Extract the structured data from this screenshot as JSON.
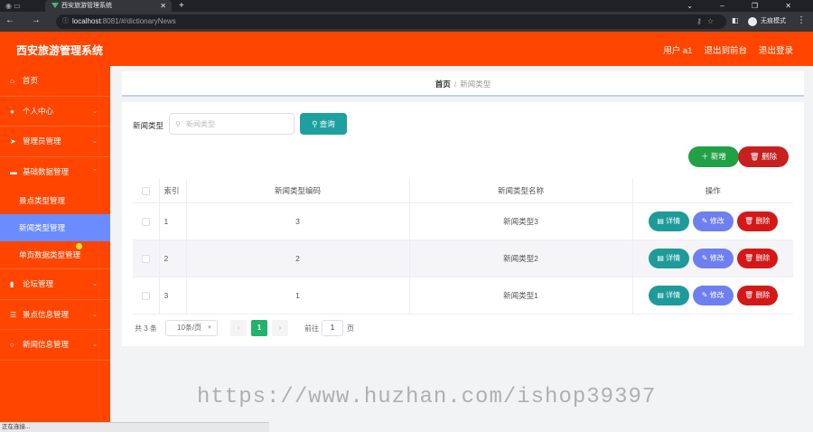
{
  "browser": {
    "tab_title": "西安旅游管理系统",
    "url_host": "localhost",
    "url_rest": ":8081/#/dictionaryNews",
    "incognito_label": "无痕模式"
  },
  "header": {
    "title": "西安旅游管理系统",
    "user": "用户 a1",
    "to_front": "退出到前台",
    "logout": "退出登录"
  },
  "sidebar": {
    "items": [
      {
        "label": "首页",
        "icon": "home-icon",
        "has_arrow": false
      },
      {
        "label": "个人中心",
        "icon": "user-icon",
        "has_arrow": true
      },
      {
        "label": "管理员管理",
        "icon": "send-icon",
        "has_arrow": true
      },
      {
        "label": "基础数据管理",
        "icon": "monitor-icon",
        "has_arrow": true,
        "expanded": true,
        "children": [
          "景点类型管理",
          "新闻类型管理",
          "单页数据类型管理"
        ]
      },
      {
        "label": "论坛管理",
        "icon": "chart-icon",
        "has_arrow": true
      },
      {
        "label": "景点信息管理",
        "icon": "list-icon",
        "has_arrow": true
      },
      {
        "label": "新闻信息管理",
        "icon": "info-icon",
        "has_arrow": true
      }
    ],
    "active_child": "新闻类型管理"
  },
  "breadcrumb": {
    "home": "首页",
    "current": "新闻类型"
  },
  "search": {
    "label": "新闻类型",
    "placeholder": "新闻类型",
    "value": "",
    "query_label": "查询"
  },
  "toolbar": {
    "add_label": "新增",
    "delete_label": "删除"
  },
  "table": {
    "headers": [
      "索引",
      "新闻类型编码",
      "新闻类型名称",
      "操作"
    ],
    "rows": [
      {
        "index": "1",
        "code": "3",
        "name": "新闻类型3"
      },
      {
        "index": "2",
        "code": "2",
        "name": "新闻类型2"
      },
      {
        "index": "3",
        "code": "1",
        "name": "新闻类型1"
      }
    ],
    "ops": {
      "detail": "详情",
      "edit": "修改",
      "delete": "删除"
    }
  },
  "pagination": {
    "total": "共 3 条",
    "page_size": "10条/页",
    "current_page": "1",
    "goto_label": "前往",
    "goto_value": "1",
    "unit": "页"
  },
  "watermark": "https://www.huzhan.com/ishop39397",
  "status_text": "正在连接...",
  "colors": {
    "header_bg": "#ff4500",
    "sidebar_active": "#6b8cff",
    "query_btn": "#1fa0a0",
    "add_btn": "#21a146",
    "delete_btn": "#c72020",
    "edit_btn": "#6e7fef",
    "page_active": "#21b36b"
  }
}
